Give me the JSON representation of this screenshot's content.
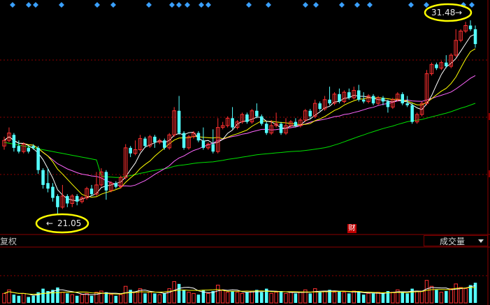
{
  "colors": {
    "up": "#ff3030",
    "down": "#54ffff",
    "ma5": "#ffffff",
    "ma10": "#ffff00",
    "ma20": "#ff66ff",
    "ma60": "#00e000",
    "grid": "#8b0000",
    "annotation": "#ffff00",
    "event_marker": "#3aa0ff",
    "badge": "#c00000"
  },
  "annotations": {
    "high_label": "31.48",
    "low_label": "21.05"
  },
  "indicator_tab": {
    "label": "复权"
  },
  "volume_selector": {
    "label": "成交量"
  },
  "event_badge": {
    "label": "财"
  },
  "chart_data": {
    "type": "candlestick",
    "title": "",
    "xlabel": "",
    "ylabel": "",
    "ylim": [
      20.0,
      32.2
    ],
    "high": 31.48,
    "low": 21.05,
    "series": [
      {
        "name": "MA5",
        "values": []
      },
      {
        "name": "MA10",
        "values": []
      },
      {
        "name": "MA20",
        "values": []
      },
      {
        "name": "MA60",
        "values": []
      }
    ],
    "candles": [
      [
        24.7,
        25.0,
        24.5,
        25.2
      ],
      [
        25.0,
        25.4,
        24.9,
        25.7
      ],
      [
        25.3,
        24.6,
        24.4,
        25.4
      ],
      [
        24.7,
        24.4,
        24.3,
        25.0
      ],
      [
        24.4,
        24.8,
        24.3,
        24.9
      ],
      [
        24.6,
        24.4,
        24.3,
        24.7
      ],
      [
        24.7,
        24.6,
        24.5,
        24.8
      ],
      [
        24.6,
        23.4,
        23.2,
        24.7
      ],
      [
        23.4,
        22.6,
        22.4,
        23.5
      ],
      [
        22.7,
        22.4,
        22.2,
        23.5
      ],
      [
        22.5,
        21.9,
        21.7,
        22.7
      ],
      [
        22.0,
        21.4,
        21.05,
        22.1
      ],
      [
        21.4,
        22.0,
        21.3,
        22.6
      ],
      [
        22.0,
        21.6,
        21.4,
        22.1
      ],
      [
        21.6,
        22.0,
        21.4,
        22.1
      ],
      [
        22.0,
        21.7,
        21.5,
        22.1
      ],
      [
        21.7,
        21.9,
        21.6,
        22.0
      ],
      [
        21.9,
        22.4,
        21.8,
        22.5
      ],
      [
        22.4,
        22.1,
        22.0,
        22.6
      ],
      [
        22.1,
        22.6,
        22.0,
        23.3
      ],
      [
        22.6,
        23.3,
        22.5,
        23.5
      ],
      [
        23.3,
        22.3,
        21.8,
        23.4
      ],
      [
        22.3,
        22.7,
        22.2,
        22.8
      ],
      [
        22.7,
        22.5,
        22.4,
        22.8
      ],
      [
        22.5,
        23.0,
        22.4,
        23.1
      ],
      [
        23.0,
        24.6,
        22.9,
        24.8
      ],
      [
        24.6,
        24.3,
        24.1,
        24.7
      ],
      [
        24.3,
        24.5,
        24.2,
        25.0
      ],
      [
        24.5,
        25.1,
        24.4,
        25.3
      ],
      [
        25.1,
        24.7,
        24.6,
        25.2
      ],
      [
        24.7,
        25.2,
        24.6,
        25.3
      ],
      [
        25.2,
        24.9,
        24.6,
        25.3
      ],
      [
        24.9,
        25.0,
        24.8,
        25.1
      ],
      [
        25.0,
        24.6,
        24.5,
        25.1
      ],
      [
        24.6,
        25.3,
        24.5,
        25.4
      ],
      [
        25.3,
        26.6,
        25.2,
        26.8
      ],
      [
        26.6,
        25.4,
        25.3,
        27.4
      ],
      [
        25.4,
        24.6,
        24.5,
        25.5
      ],
      [
        24.6,
        25.2,
        24.5,
        25.3
      ],
      [
        25.2,
        25.4,
        25.1,
        25.5
      ],
      [
        25.4,
        25.0,
        24.9,
        25.5
      ],
      [
        25.0,
        24.6,
        24.5,
        25.7
      ],
      [
        24.6,
        24.8,
        24.5,
        24.9
      ],
      [
        24.8,
        24.4,
        24.3,
        25.6
      ],
      [
        24.4,
        25.7,
        24.3,
        26.2
      ],
      [
        25.7,
        25.8,
        25.6,
        26.0
      ],
      [
        25.8,
        26.2,
        25.7,
        26.3
      ],
      [
        26.2,
        25.7,
        25.6,
        26.8
      ],
      [
        25.7,
        26.0,
        25.6,
        26.1
      ],
      [
        26.0,
        26.4,
        25.9,
        26.5
      ],
      [
        26.4,
        26.0,
        25.9,
        26.5
      ],
      [
        26.0,
        26.6,
        25.9,
        26.7
      ],
      [
        26.6,
        26.3,
        26.2,
        27.0
      ],
      [
        26.3,
        25.9,
        25.8,
        26.4
      ],
      [
        25.9,
        25.4,
        25.3,
        26.0
      ],
      [
        25.4,
        25.8,
        25.3,
        26.1
      ],
      [
        25.8,
        25.9,
        25.7,
        26.5
      ],
      [
        25.9,
        25.4,
        25.3,
        26.0
      ],
      [
        25.4,
        25.8,
        25.3,
        26.2
      ],
      [
        25.8,
        26.0,
        25.7,
        26.1
      ],
      [
        26.0,
        25.8,
        25.7,
        26.2
      ],
      [
        25.8,
        26.1,
        25.7,
        26.2
      ],
      [
        26.1,
        26.6,
        26.0,
        26.7
      ],
      [
        26.6,
        26.3,
        26.2,
        26.7
      ],
      [
        26.3,
        27.0,
        26.2,
        27.2
      ],
      [
        27.0,
        26.7,
        26.6,
        27.1
      ],
      [
        26.7,
        27.2,
        26.6,
        27.4
      ],
      [
        27.2,
        27.0,
        26.9,
        27.9
      ],
      [
        27.0,
        27.5,
        26.9,
        27.6
      ],
      [
        27.5,
        27.1,
        27.0,
        27.8
      ],
      [
        27.1,
        27.6,
        27.0,
        27.7
      ],
      [
        27.6,
        27.3,
        27.2,
        27.8
      ],
      [
        27.3,
        27.7,
        27.2,
        27.9
      ],
      [
        27.7,
        27.2,
        27.1,
        28.0
      ],
      [
        27.2,
        27.1,
        27.0,
        27.6
      ],
      [
        27.1,
        27.4,
        27.0,
        27.5
      ],
      [
        27.4,
        27.0,
        26.9,
        27.5
      ],
      [
        27.0,
        27.3,
        26.9,
        27.4
      ],
      [
        27.3,
        27.1,
        26.9,
        27.4
      ],
      [
        27.1,
        26.8,
        26.5,
        27.2
      ],
      [
        26.8,
        27.2,
        26.7,
        27.3
      ],
      [
        27.2,
        27.5,
        27.1,
        27.6
      ],
      [
        27.5,
        27.0,
        26.9,
        27.6
      ],
      [
        27.0,
        26.9,
        26.8,
        27.4
      ],
      [
        26.9,
        26.0,
        25.9,
        27.0
      ],
      [
        26.0,
        26.4,
        25.9,
        26.5
      ],
      [
        26.4,
        27.0,
        26.3,
        27.1
      ],
      [
        27.0,
        28.6,
        26.9,
        28.8
      ],
      [
        28.6,
        29.1,
        28.5,
        29.2
      ],
      [
        29.1,
        28.9,
        28.8,
        29.2
      ],
      [
        28.9,
        29.2,
        28.8,
        29.3
      ],
      [
        29.2,
        29.0,
        28.9,
        29.6
      ],
      [
        29.0,
        29.6,
        28.9,
        29.7
      ],
      [
        29.6,
        30.4,
        29.5,
        31.0
      ],
      [
        30.4,
        30.9,
        30.3,
        31.0
      ],
      [
        30.9,
        31.2,
        30.8,
        31.4
      ],
      [
        31.2,
        31.0,
        30.9,
        31.48
      ],
      [
        31.0,
        30.2,
        30.0,
        31.2
      ]
    ],
    "volumes": [
      40,
      55,
      35,
      30,
      40,
      25,
      30,
      45,
      60,
      50,
      55,
      65,
      45,
      40,
      35,
      30,
      35,
      40,
      30,
      45,
      50,
      45,
      35,
      30,
      35,
      70,
      55,
      45,
      60,
      40,
      45,
      40,
      35,
      40,
      60,
      90,
      80,
      55,
      45,
      40,
      35,
      55,
      40,
      50,
      75,
      55,
      45,
      50,
      45,
      40,
      45,
      50,
      55,
      45,
      60,
      40,
      45,
      50,
      40,
      45,
      40,
      45,
      55,
      40,
      60,
      45,
      50,
      55,
      45,
      50,
      45,
      40,
      50,
      45,
      35,
      40,
      40,
      45,
      40,
      50,
      45,
      55,
      45,
      40,
      60,
      50,
      50,
      95,
      70,
      55,
      45,
      50,
      60,
      80,
      65,
      60,
      75,
      85
    ]
  }
}
